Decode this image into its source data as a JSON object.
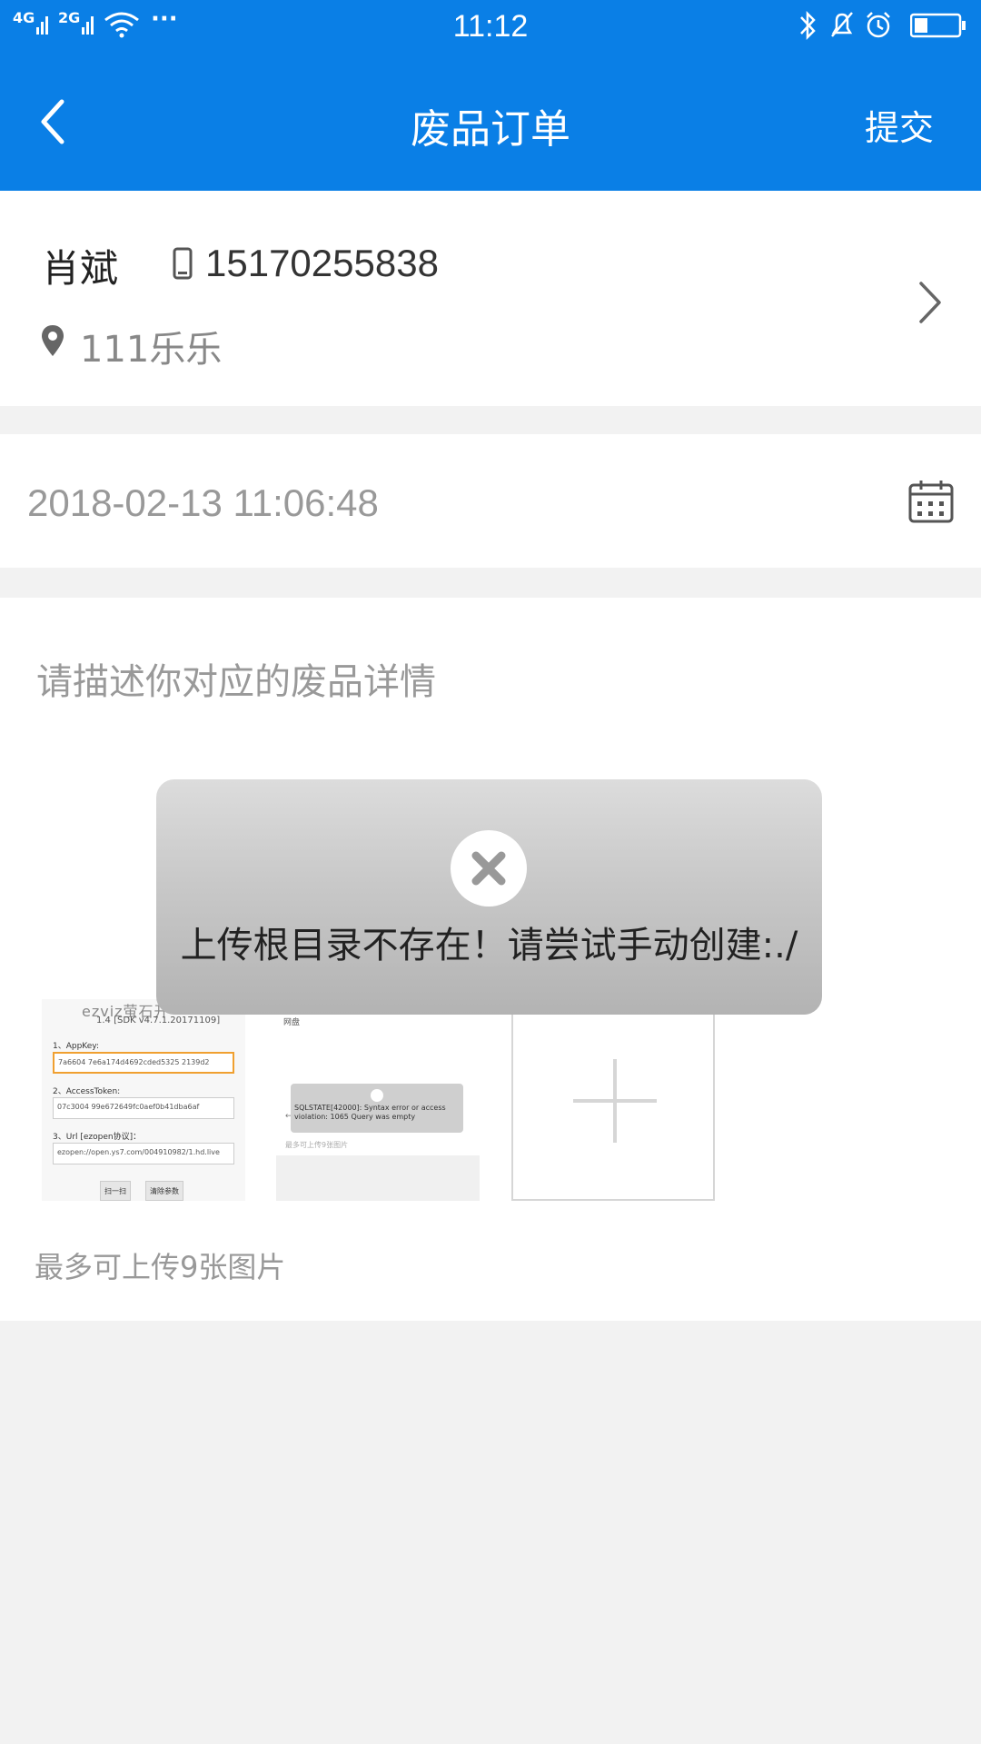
{
  "status_bar": {
    "network1": "4G",
    "network2": "2G",
    "more": "···",
    "time": "11:12"
  },
  "header": {
    "title": "废品订单",
    "submit_label": "提交"
  },
  "contact": {
    "name": "肖斌",
    "phone": "15170255838",
    "address": "111乐乐"
  },
  "date": {
    "value": "2018-02-13 11:06:48"
  },
  "description": {
    "placeholder": "请描述你对应的废品详情"
  },
  "upload": {
    "max_hint": "最多可上传9张图片",
    "thumb1": {
      "logo_text": "ezviz萤石开",
      "version": "1.4 [SDK v4.7.1.20171109]",
      "appkey_label": "1、AppKey:",
      "appkey_value": "7a6604 7e6a174d4692cded5325 2139d2",
      "token_label": "2、AccessToken:",
      "token_value": "07c3004 99e672649fc0aef0b41dba6af",
      "url_label": "3、Url [ezopen协议]：",
      "url_value": "ezopen://open.ys7.com/004910982/1.hd.live",
      "btn1": "扫一扫",
      "btn2": "清除参数"
    },
    "thumb2": {
      "top_text": "网盘",
      "toast_text": "SQLSTATE[42000]: Syntax error or access violation: 1065 Query was empty",
      "dot_text": "←",
      "foot_text": "最多可上传9张图片"
    }
  },
  "toast": {
    "message": "上传根目录不存在！请尝试手动创建:./"
  },
  "colors": {
    "primary": "#0a7fe6",
    "background": "#f2f2f2"
  }
}
